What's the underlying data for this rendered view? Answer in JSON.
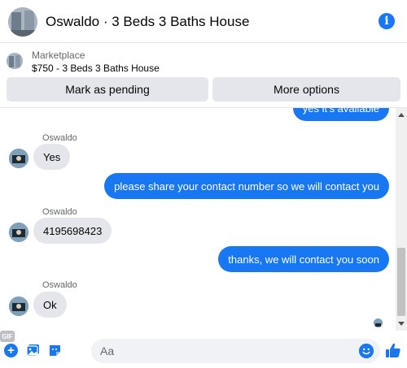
{
  "header": {
    "title": "Oswaldo · 3 Beds 3 Baths House",
    "info_icon": "info-icon"
  },
  "marketplace": {
    "label": "Marketplace",
    "listing": "$750 - 3 Beds 3 Baths House",
    "mark_pending": "Mark as pending",
    "more_options": "More options"
  },
  "messages": [
    {
      "from": "me",
      "text": "yes it's available"
    },
    {
      "from": "them",
      "sender": "Oswaldo",
      "text": "Yes"
    },
    {
      "from": "me",
      "text": "please share your contact number so we will contact you"
    },
    {
      "from": "them",
      "sender": "Oswaldo",
      "text": "4195698423"
    },
    {
      "from": "me",
      "text": "thanks, we will contact you soon"
    },
    {
      "from": "them",
      "sender": "Oswaldo",
      "text": "Ok"
    }
  ],
  "composer": {
    "placeholder": "Aa",
    "gif_label": "GIF",
    "icons": [
      "plus-icon",
      "photo-icon",
      "sticker-icon",
      "gif-icon",
      "emoji-icon",
      "like-icon"
    ]
  },
  "colors": {
    "accent": "#1877f2",
    "bubble_in": "#e4e6eb",
    "secondary_text": "#65676b"
  }
}
